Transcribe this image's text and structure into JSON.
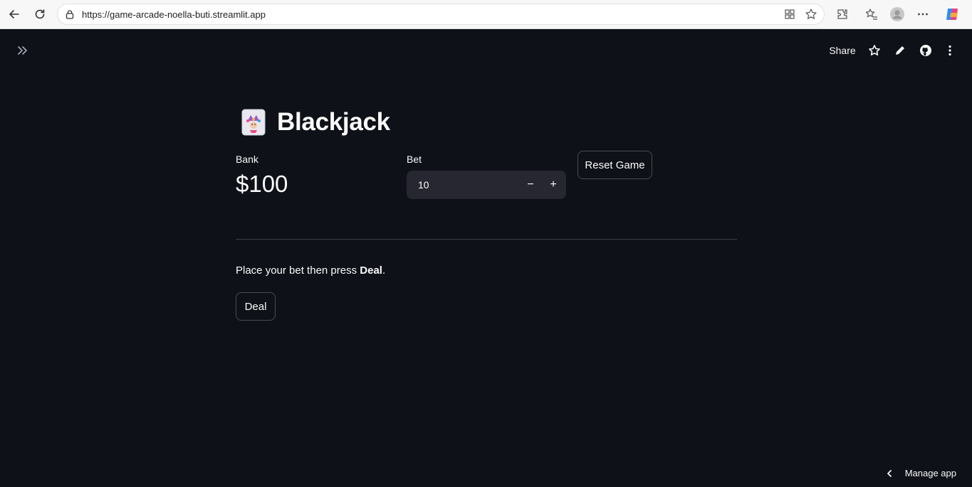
{
  "browser": {
    "url": "https://game-arcade-noella-buti.streamlit.app"
  },
  "header": {
    "share_label": "Share"
  },
  "title": {
    "emoji": "joker-card",
    "text": "Blackjack"
  },
  "bank": {
    "label": "Bank",
    "value": "$100"
  },
  "bet": {
    "label": "Bet",
    "value": "10",
    "decrement": "−",
    "increment": "+"
  },
  "reset_button": "Reset Game",
  "instruction": {
    "prefix": "Place your bet then press ",
    "bold": "Deal",
    "suffix": "."
  },
  "deal_button": "Deal",
  "footer": {
    "manage_label": "Manage app"
  }
}
